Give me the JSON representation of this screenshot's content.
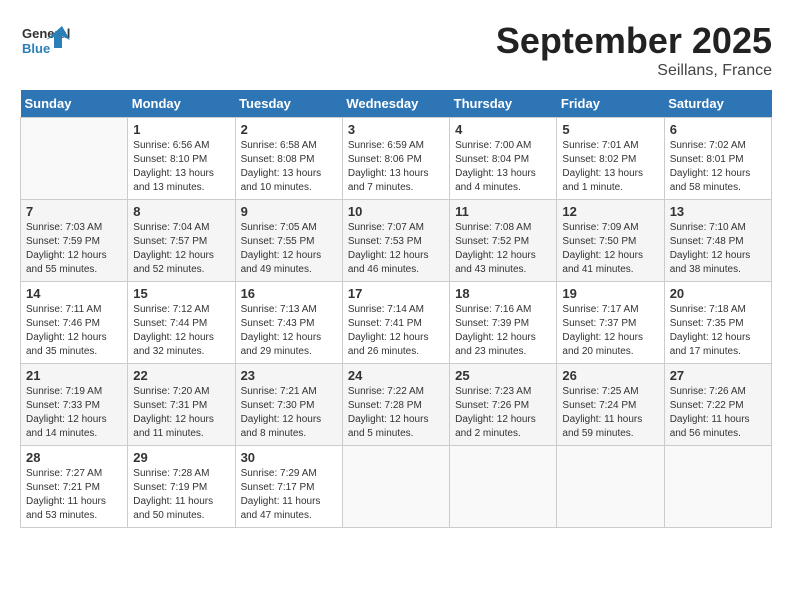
{
  "header": {
    "logo_general": "General",
    "logo_blue": "Blue",
    "month": "September 2025",
    "location": "Seillans, France"
  },
  "days_of_week": [
    "Sunday",
    "Monday",
    "Tuesday",
    "Wednesday",
    "Thursday",
    "Friday",
    "Saturday"
  ],
  "weeks": [
    [
      {
        "num": "",
        "empty": true
      },
      {
        "num": "1",
        "sunrise": "Sunrise: 6:56 AM",
        "sunset": "Sunset: 8:10 PM",
        "daylight": "Daylight: 13 hours and 13 minutes."
      },
      {
        "num": "2",
        "sunrise": "Sunrise: 6:58 AM",
        "sunset": "Sunset: 8:08 PM",
        "daylight": "Daylight: 13 hours and 10 minutes."
      },
      {
        "num": "3",
        "sunrise": "Sunrise: 6:59 AM",
        "sunset": "Sunset: 8:06 PM",
        "daylight": "Daylight: 13 hours and 7 minutes."
      },
      {
        "num": "4",
        "sunrise": "Sunrise: 7:00 AM",
        "sunset": "Sunset: 8:04 PM",
        "daylight": "Daylight: 13 hours and 4 minutes."
      },
      {
        "num": "5",
        "sunrise": "Sunrise: 7:01 AM",
        "sunset": "Sunset: 8:02 PM",
        "daylight": "Daylight: 13 hours and 1 minute."
      },
      {
        "num": "6",
        "sunrise": "Sunrise: 7:02 AM",
        "sunset": "Sunset: 8:01 PM",
        "daylight": "Daylight: 12 hours and 58 minutes."
      }
    ],
    [
      {
        "num": "7",
        "sunrise": "Sunrise: 7:03 AM",
        "sunset": "Sunset: 7:59 PM",
        "daylight": "Daylight: 12 hours and 55 minutes."
      },
      {
        "num": "8",
        "sunrise": "Sunrise: 7:04 AM",
        "sunset": "Sunset: 7:57 PM",
        "daylight": "Daylight: 12 hours and 52 minutes."
      },
      {
        "num": "9",
        "sunrise": "Sunrise: 7:05 AM",
        "sunset": "Sunset: 7:55 PM",
        "daylight": "Daylight: 12 hours and 49 minutes."
      },
      {
        "num": "10",
        "sunrise": "Sunrise: 7:07 AM",
        "sunset": "Sunset: 7:53 PM",
        "daylight": "Daylight: 12 hours and 46 minutes."
      },
      {
        "num": "11",
        "sunrise": "Sunrise: 7:08 AM",
        "sunset": "Sunset: 7:52 PM",
        "daylight": "Daylight: 12 hours and 43 minutes."
      },
      {
        "num": "12",
        "sunrise": "Sunrise: 7:09 AM",
        "sunset": "Sunset: 7:50 PM",
        "daylight": "Daylight: 12 hours and 41 minutes."
      },
      {
        "num": "13",
        "sunrise": "Sunrise: 7:10 AM",
        "sunset": "Sunset: 7:48 PM",
        "daylight": "Daylight: 12 hours and 38 minutes."
      }
    ],
    [
      {
        "num": "14",
        "sunrise": "Sunrise: 7:11 AM",
        "sunset": "Sunset: 7:46 PM",
        "daylight": "Daylight: 12 hours and 35 minutes."
      },
      {
        "num": "15",
        "sunrise": "Sunrise: 7:12 AM",
        "sunset": "Sunset: 7:44 PM",
        "daylight": "Daylight: 12 hours and 32 minutes."
      },
      {
        "num": "16",
        "sunrise": "Sunrise: 7:13 AM",
        "sunset": "Sunset: 7:43 PM",
        "daylight": "Daylight: 12 hours and 29 minutes."
      },
      {
        "num": "17",
        "sunrise": "Sunrise: 7:14 AM",
        "sunset": "Sunset: 7:41 PM",
        "daylight": "Daylight: 12 hours and 26 minutes."
      },
      {
        "num": "18",
        "sunrise": "Sunrise: 7:16 AM",
        "sunset": "Sunset: 7:39 PM",
        "daylight": "Daylight: 12 hours and 23 minutes."
      },
      {
        "num": "19",
        "sunrise": "Sunrise: 7:17 AM",
        "sunset": "Sunset: 7:37 PM",
        "daylight": "Daylight: 12 hours and 20 minutes."
      },
      {
        "num": "20",
        "sunrise": "Sunrise: 7:18 AM",
        "sunset": "Sunset: 7:35 PM",
        "daylight": "Daylight: 12 hours and 17 minutes."
      }
    ],
    [
      {
        "num": "21",
        "sunrise": "Sunrise: 7:19 AM",
        "sunset": "Sunset: 7:33 PM",
        "daylight": "Daylight: 12 hours and 14 minutes."
      },
      {
        "num": "22",
        "sunrise": "Sunrise: 7:20 AM",
        "sunset": "Sunset: 7:31 PM",
        "daylight": "Daylight: 12 hours and 11 minutes."
      },
      {
        "num": "23",
        "sunrise": "Sunrise: 7:21 AM",
        "sunset": "Sunset: 7:30 PM",
        "daylight": "Daylight: 12 hours and 8 minutes."
      },
      {
        "num": "24",
        "sunrise": "Sunrise: 7:22 AM",
        "sunset": "Sunset: 7:28 PM",
        "daylight": "Daylight: 12 hours and 5 minutes."
      },
      {
        "num": "25",
        "sunrise": "Sunrise: 7:23 AM",
        "sunset": "Sunset: 7:26 PM",
        "daylight": "Daylight: 12 hours and 2 minutes."
      },
      {
        "num": "26",
        "sunrise": "Sunrise: 7:25 AM",
        "sunset": "Sunset: 7:24 PM",
        "daylight": "Daylight: 11 hours and 59 minutes."
      },
      {
        "num": "27",
        "sunrise": "Sunrise: 7:26 AM",
        "sunset": "Sunset: 7:22 PM",
        "daylight": "Daylight: 11 hours and 56 minutes."
      }
    ],
    [
      {
        "num": "28",
        "sunrise": "Sunrise: 7:27 AM",
        "sunset": "Sunset: 7:21 PM",
        "daylight": "Daylight: 11 hours and 53 minutes."
      },
      {
        "num": "29",
        "sunrise": "Sunrise: 7:28 AM",
        "sunset": "Sunset: 7:19 PM",
        "daylight": "Daylight: 11 hours and 50 minutes."
      },
      {
        "num": "30",
        "sunrise": "Sunrise: 7:29 AM",
        "sunset": "Sunset: 7:17 PM",
        "daylight": "Daylight: 11 hours and 47 minutes."
      },
      {
        "num": "",
        "empty": true
      },
      {
        "num": "",
        "empty": true
      },
      {
        "num": "",
        "empty": true
      },
      {
        "num": "",
        "empty": true
      }
    ]
  ]
}
